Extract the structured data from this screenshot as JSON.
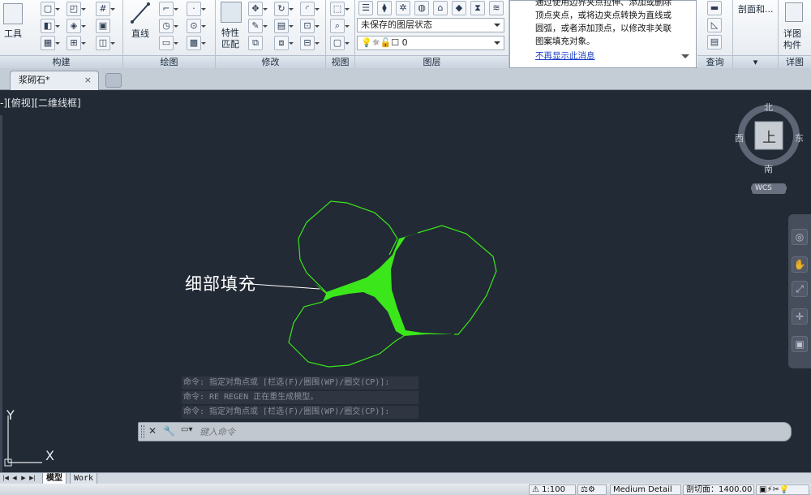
{
  "ribbon": {
    "panels": {
      "build": "构建",
      "draw": "绘图",
      "modify": "修改",
      "view": "视图",
      "layers": "图层",
      "query": "查询",
      "detail": "详图"
    },
    "tools_label": "工具",
    "line_label": "直线",
    "match_props_label_1": "特性",
    "match_props_label_2": "匹配",
    "layer_state": "未保存的图层状态",
    "current_layer": "0",
    "section_label": "剖面和...",
    "detail_component_label_1": "详图",
    "detail_component_label_2": "构件"
  },
  "tooltip": {
    "lines": [
      "通过使用边界夹点拉伸、添加或删除",
      "顶点夹点，或将边夹点转换为直线或",
      "圆弧，或者添加顶点，以修改非关联",
      "图案填充对象。"
    ],
    "dont_show_again": "不再显示此消息"
  },
  "document_tab": {
    "title": "浆砌石*",
    "close": "×"
  },
  "viewport": {
    "label": "-][俯视][二维线框]"
  },
  "viewcube": {
    "north": "北",
    "south": "南",
    "east": "东",
    "west": "西",
    "face": "上",
    "wcs": "WCS"
  },
  "annotation": {
    "text": "细部填充"
  },
  "ucs": {
    "x": "X",
    "y": "Y"
  },
  "command": {
    "history": [
      "命令: 指定对角点或 [栏选(F)/圈围(WP)/圈交(CP)]:",
      "命令: RE REGEN 正在重生成模型。",
      "命令: 指定对角点或 [栏选(F)/圈围(WP)/圈交(CP)]:"
    ],
    "placeholder": "键入命令"
  },
  "layout_tabs": {
    "model": "模型",
    "work": "Work"
  },
  "status": {
    "scale": "1:100",
    "detail_level": "Medium Detail",
    "cut_plane": "剖切面：1400.00"
  },
  "colors": {
    "hatch": "#3be61a",
    "background": "#222a35"
  }
}
